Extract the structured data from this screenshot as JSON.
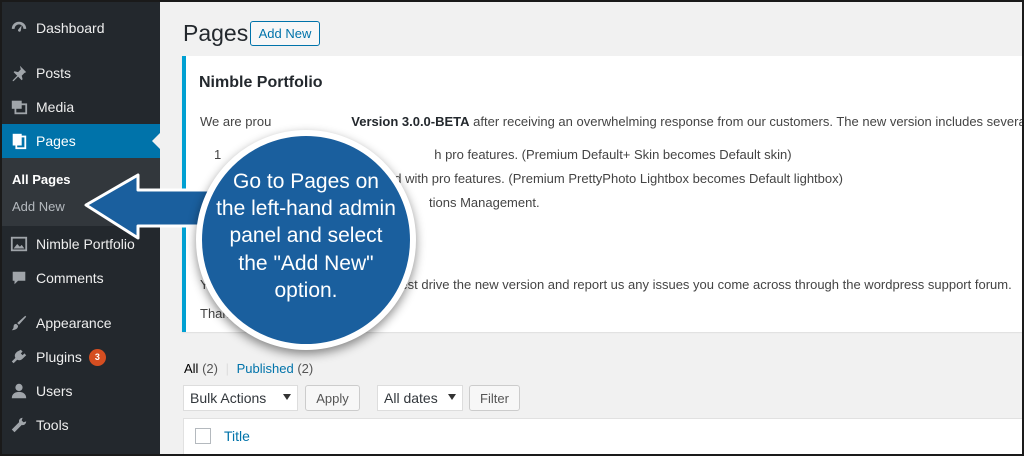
{
  "sidebar": {
    "items": [
      {
        "label": "Dashboard",
        "icon": "dashboard-icon"
      },
      {
        "label": "Posts",
        "icon": "pin-icon"
      },
      {
        "label": "Media",
        "icon": "media-icon"
      },
      {
        "label": "Pages",
        "icon": "pages-icon"
      },
      {
        "label": "Nimble Portfolio",
        "icon": "portfolio-icon"
      },
      {
        "label": "Comments",
        "icon": "comment-icon"
      },
      {
        "label": "Appearance",
        "icon": "brush-icon"
      },
      {
        "label": "Plugins",
        "icon": "plug-icon"
      },
      {
        "label": "Users",
        "icon": "user-icon"
      },
      {
        "label": "Tools",
        "icon": "wrench-icon"
      }
    ],
    "submenu": {
      "all_pages": "All Pages",
      "add_new": "Add New"
    },
    "plugins_badge": "3",
    "colors": {
      "bg": "#23282d",
      "active": "#0073aa",
      "badge": "#d54e21"
    }
  },
  "header": {
    "title": "Pages",
    "add_new": "Add New"
  },
  "notice": {
    "title": "Nimble Portfolio",
    "line1_pre": "We are prou",
    "line1_bold": "Version 3.0.0-BETA",
    "line1_post": " after receiving an overwhelming response from our customers. The new version includes several ne",
    "item1_pre": "1",
    "item1_post": "h pro features. (Premium Default+ Skin becomes Default skin)",
    "item2": "ed with pro features. (Premium PrettyPhoto Lightbox becomes Default lightbox)",
    "item3": "tions Management.",
    "line_you_pre": "You",
    "line_you_post": "d test drive the new version and report us any issues you come across through the wordpress support forum.",
    "line_thank": "Thank yo"
  },
  "filters": {
    "all_label": "All",
    "all_count": "(2)",
    "separator": "|",
    "published_label": "Published",
    "published_count": "(2)",
    "bulk_actions": "Bulk Actions",
    "apply": "Apply",
    "all_dates": "All dates",
    "filter": "Filter"
  },
  "table": {
    "title_col": "Title"
  },
  "callout": {
    "text": "Go to Pages on the left-hand admin panel and select the \"Add New\" option.",
    "color": "#1a5f9e"
  }
}
